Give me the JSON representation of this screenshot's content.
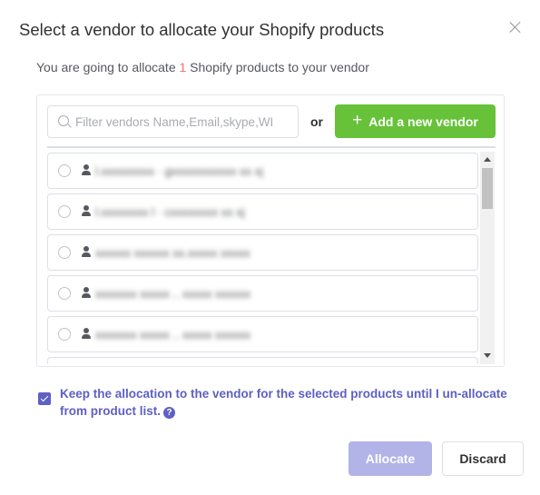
{
  "dialog": {
    "title": "Select a vendor to allocate your Shopify products",
    "close_icon": "close-icon",
    "subtitle_prefix": "You are going to allocate ",
    "product_count": "1",
    "subtitle_suffix": " Shopify products to your vendor"
  },
  "search": {
    "placeholder": "Filter vendors Name,Email,skype,WI",
    "value": "",
    "icon": "search-icon"
  },
  "or_label": "or",
  "add_vendor_button": {
    "icon": "plus-icon",
    "label": "Add a new vendor"
  },
  "vendors": [
    {
      "name": "l.xxxxxxxxx  ·  gxxxxxxxxxxx xx xj"
    },
    {
      "name": "l.xxxxxxxx l  ·  cxxxxxxxx xx xj"
    },
    {
      "name": "xxxxxx xxxxxx xx.xxxxx xxxxx"
    },
    {
      "name": "xxxxxxx xxxxx .. xxxxx xxxxxx"
    },
    {
      "name": "xxxxxxx xxxxx .. xxxxx xxxxxx"
    }
  ],
  "keep_allocation": {
    "checked": true,
    "text": "Keep the allocation to the vendor for the selected products until I un-allocate from product list.",
    "help_icon": "question-circle-icon"
  },
  "footer": {
    "allocate_label": "Allocate",
    "discard_label": "Discard"
  },
  "colors": {
    "primary": "#5e60c3",
    "primary_disabled": "#b2b3e7",
    "success": "#67c23a",
    "danger": "#f56c6c"
  }
}
